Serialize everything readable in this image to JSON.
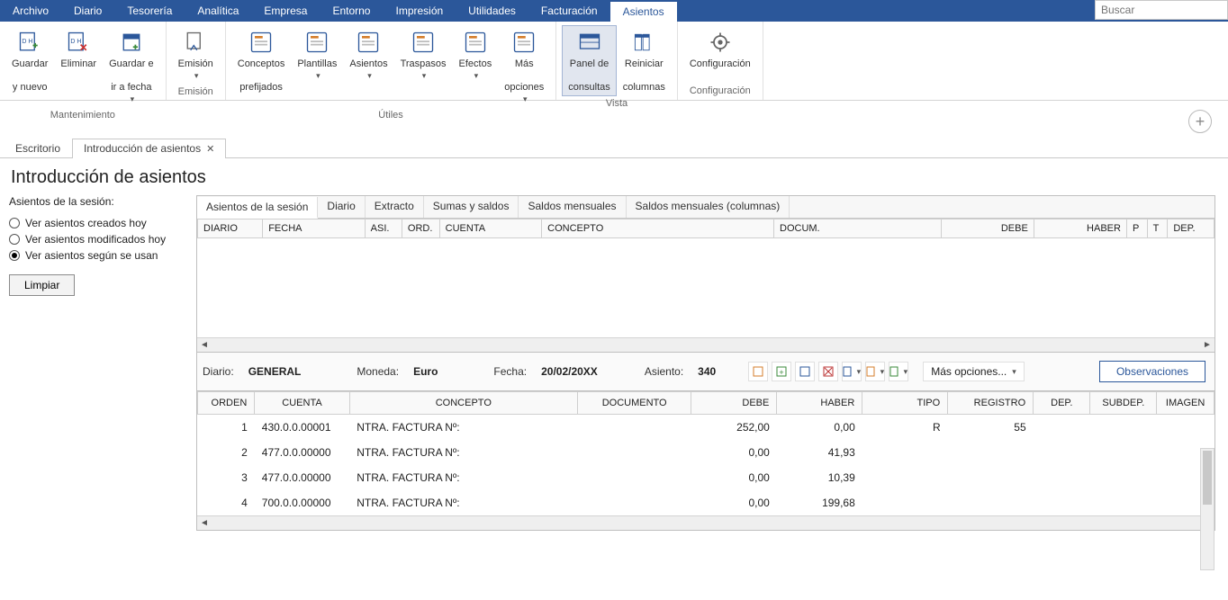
{
  "search_placeholder": "Buscar",
  "menu": [
    "Archivo",
    "Diario",
    "Tesorería",
    "Analítica",
    "Empresa",
    "Entorno",
    "Impresión",
    "Utilidades",
    "Facturación",
    "Asientos"
  ],
  "menu_active": 9,
  "ribbon": {
    "groups": [
      {
        "caption": "Mantenimiento",
        "buttons": [
          {
            "label": "Guardar\ny nuevo",
            "name": "guardar-y-nuevo-button"
          },
          {
            "label": "Eliminar",
            "name": "eliminar-button"
          },
          {
            "label": "Guardar e\nir a fecha",
            "name": "guardar-ir-fecha-button",
            "dd": true
          }
        ]
      },
      {
        "caption": "Emisión",
        "buttons": [
          {
            "label": "Emisión",
            "name": "emision-button",
            "dd": true
          }
        ]
      },
      {
        "caption": "Útiles",
        "buttons": [
          {
            "label": "Conceptos\nprefijados",
            "name": "conceptos-prefijados-button"
          },
          {
            "label": "Plantillas",
            "name": "plantillas-button",
            "dd": true
          },
          {
            "label": "Asientos",
            "name": "asientos-util-button",
            "dd": true
          },
          {
            "label": "Traspasos",
            "name": "traspasos-button",
            "dd": true
          },
          {
            "label": "Efectos",
            "name": "efectos-button",
            "dd": true
          },
          {
            "label": "Más\nopciones",
            "name": "mas-opciones-button",
            "dd": true
          }
        ]
      },
      {
        "caption": "Vista",
        "buttons": [
          {
            "label": "Panel de\nconsultas",
            "name": "panel-consultas-button",
            "selected": true
          },
          {
            "label": "Reiniciar\ncolumnas",
            "name": "reiniciar-columnas-button"
          }
        ]
      },
      {
        "caption": "Configuración",
        "buttons": [
          {
            "label": "Configuración",
            "name": "configuracion-button"
          }
        ]
      }
    ]
  },
  "doctabs": [
    {
      "label": "Escritorio",
      "closable": false
    },
    {
      "label": "Introducción de asientos",
      "closable": true,
      "active": true
    }
  ],
  "page_title": "Introducción de asientos",
  "left": {
    "header": "Asientos de la sesión:",
    "radios": [
      {
        "label": "Ver asientos creados hoy"
      },
      {
        "label": "Ver asientos modificados hoy"
      },
      {
        "label": "Ver asientos según se usan",
        "selected": true
      }
    ],
    "limpiar": "Limpiar"
  },
  "inner_tabs": [
    "Asientos de la sesión",
    "Diario",
    "Extracto",
    "Sumas y saldos",
    "Saldos mensuales",
    "Saldos mensuales (columnas)"
  ],
  "inner_tab_active": 0,
  "top_headers": [
    "DIARIO",
    "FECHA",
    "ASI.",
    "ORD.",
    "CUENTA",
    "CONCEPTO",
    "DOCUM.",
    "DEBE",
    "HABER",
    "P",
    "T",
    "DEP."
  ],
  "info": {
    "diario_lbl": "Diario:",
    "diario": "GENERAL",
    "moneda_lbl": "Moneda:",
    "moneda": "Euro",
    "fecha_lbl": "Fecha:",
    "fecha": "20/02/20XX",
    "asiento_lbl": "Asiento:",
    "asiento": "340",
    "more": "Más opciones...",
    "obs": "Observaciones"
  },
  "bottom_headers": [
    "ORDEN",
    "CUENTA",
    "CONCEPTO",
    "DOCUMENTO",
    "DEBE",
    "HABER",
    "TIPO",
    "REGISTRO",
    "DEP.",
    "SUBDEP.",
    "IMAGEN"
  ],
  "rows": [
    {
      "orden": "1",
      "cuenta": "430.0.0.00001",
      "concepto": "NTRA. FACTURA Nº:",
      "documento": "",
      "debe": "252,00",
      "haber": "0,00",
      "tipo": "R",
      "registro": "55",
      "dep": "",
      "subdep": "",
      "imagen": ""
    },
    {
      "orden": "2",
      "cuenta": "477.0.0.00000",
      "concepto": "NTRA. FACTURA Nº:",
      "documento": "",
      "debe": "0,00",
      "haber": "41,93",
      "tipo": "",
      "registro": "",
      "dep": "",
      "subdep": "",
      "imagen": ""
    },
    {
      "orden": "3",
      "cuenta": "477.0.0.00000",
      "concepto": "NTRA. FACTURA Nº:",
      "documento": "",
      "debe": "0,00",
      "haber": "10,39",
      "tipo": "",
      "registro": "",
      "dep": "",
      "subdep": "",
      "imagen": ""
    },
    {
      "orden": "4",
      "cuenta": "700.0.0.00000",
      "concepto": "NTRA. FACTURA Nº:",
      "documento": "",
      "debe": "0,00",
      "haber": "199,68",
      "tipo": "",
      "registro": "",
      "dep": "",
      "subdep": "",
      "imagen": ""
    }
  ]
}
